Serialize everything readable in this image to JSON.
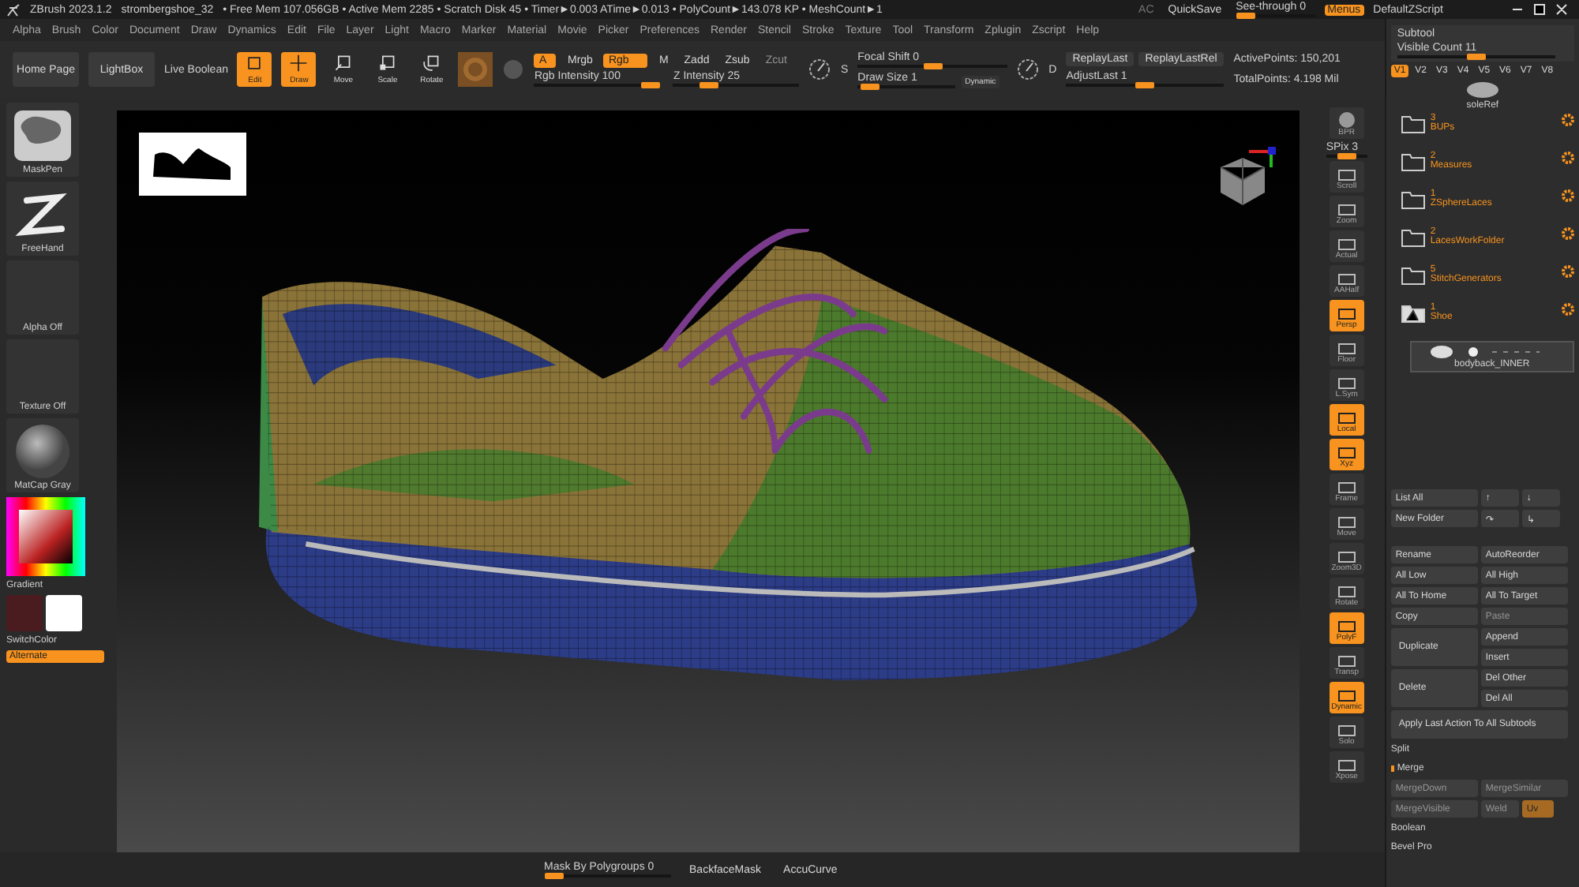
{
  "title_bar": {
    "app": "ZBrush 2023.1.2",
    "document": "strombergshoe_32",
    "stats": "• Free Mem 107.056GB • Active Mem 2285 • Scratch Disk 45 • Timer►0.003 ATime►0.013 • PolyCount►143.078 KP • MeshCount►1",
    "ac": "AC",
    "quicksave": "QuickSave",
    "see_through": {
      "label": "See-through 0",
      "level": 0
    },
    "menus": {
      "label": "Menus",
      "on": true
    },
    "script": "DefaultZScript"
  },
  "menu": [
    "Alpha",
    "Brush",
    "Color",
    "Document",
    "Draw",
    "Dynamics",
    "Edit",
    "File",
    "Layer",
    "Light",
    "Macro",
    "Marker",
    "Material",
    "Movie",
    "Picker",
    "Preferences",
    "Render",
    "Stencil",
    "Stroke",
    "Texture",
    "Tool",
    "Transform",
    "Zplugin",
    "Zscript",
    "Help"
  ],
  "toolbar": {
    "nav": [
      "Home Page",
      "LightBox"
    ],
    "live_boolean": "Live Boolean",
    "modes": [
      {
        "label": "Edit",
        "selected": true
      },
      {
        "label": "Draw",
        "selected": true
      },
      {
        "label": "Move",
        "selected": false
      },
      {
        "label": "Scale",
        "selected": false
      },
      {
        "label": "Rotate",
        "selected": false
      }
    ],
    "channels": [
      {
        "label": "A",
        "on": true,
        "disabled": false
      },
      {
        "label": "Mrgb",
        "on": false,
        "disabled": false
      },
      {
        "label": "Rgb",
        "on": true,
        "disabled": false
      },
      {
        "label": "M",
        "on": false,
        "disabled": false
      },
      {
        "label": "Zadd",
        "on": false,
        "disabled": false
      },
      {
        "label": "Zsub",
        "on": false,
        "disabled": false
      },
      {
        "label": "Zcut",
        "on": false,
        "disabled": true
      }
    ],
    "intensity": [
      {
        "label": "Rgb Intensity 100",
        "level": 1
      },
      {
        "label": "Z Intensity 25",
        "level": 0.25
      }
    ],
    "focal_letter": "S",
    "focal_shift": {
      "label": "Focal Shift 0",
      "level": 0.5
    },
    "draw_size": {
      "label": "Draw Size 1",
      "level": 0.03
    },
    "dynamic": "Dynamic",
    "adjust_letter": "D",
    "replay": [
      "ReplayLast",
      "ReplayLastRel"
    ],
    "adjust_last": {
      "label": "AdjustLast 1",
      "level": 0.5
    },
    "active_points": "ActivePoints: 150,201",
    "total_points": "TotalPoints: 4.198 Mil"
  },
  "left_shelf": {
    "items": [
      {
        "kind": "brush",
        "label": "MaskPen"
      },
      {
        "kind": "stroke",
        "label": "FreeHand"
      },
      {
        "kind": "empty",
        "label": "Alpha Off"
      },
      {
        "kind": "empty",
        "label": "Texture Off"
      },
      {
        "kind": "material",
        "label": "MatCap Gray"
      }
    ],
    "gradient": "Gradient",
    "swatches": [
      {
        "color": "#4a1c20"
      },
      {
        "color": "#ffffff"
      }
    ],
    "switch_color": "SwitchColor",
    "alternate": {
      "label": "Alternate",
      "on": true
    }
  },
  "right_shelf": {
    "bpr": "BPR",
    "spix": {
      "label": "SPix 3",
      "level": 0.5
    },
    "items": [
      {
        "label": "Scroll",
        "on": false
      },
      {
        "label": "Zoom",
        "on": false
      },
      {
        "label": "Actual",
        "on": false
      },
      {
        "label": "AAHalf",
        "on": false
      },
      {
        "label": "Persp",
        "on": true
      },
      {
        "label": "Floor",
        "on": false
      },
      {
        "label": "L.Sym",
        "on": false
      },
      {
        "label": "Local",
        "on": true
      },
      {
        "label": "Xyz",
        "on": true
      },
      {
        "label": "Frame",
        "on": false
      },
      {
        "label": "Move",
        "on": false
      },
      {
        "label": "Zoom3D",
        "on": false
      },
      {
        "label": "Rotate",
        "on": false
      },
      {
        "label": "PolyF",
        "on": true
      },
      {
        "label": "Transp",
        "on": false
      },
      {
        "label": "Dynamic",
        "on": true
      },
      {
        "label": "Solo",
        "on": false
      },
      {
        "label": "Xpose",
        "on": false
      }
    ]
  },
  "bottom_bar": {
    "mask": {
      "label": "Mask By Polygroups 0",
      "level": 0
    },
    "buttons": [
      "BackfaceMask",
      "AccuCurve"
    ]
  },
  "subtool": {
    "title": "Subtool",
    "visible_count": {
      "label": "Visible Count 11",
      "level": 0.5
    },
    "versions": [
      {
        "label": "V1",
        "selected": true
      },
      {
        "label": "V2",
        "selected": false
      },
      {
        "label": "V3",
        "selected": false
      },
      {
        "label": "V4",
        "selected": false
      },
      {
        "label": "V5",
        "selected": false
      },
      {
        "label": "V6",
        "selected": false
      },
      {
        "label": "V7",
        "selected": false
      },
      {
        "label": "V8",
        "selected": false
      }
    ],
    "top_item": "soleRef",
    "folders": [
      {
        "count": "3",
        "name": "BUPs",
        "expanded": false
      },
      {
        "count": "2",
        "name": "Measures",
        "expanded": false
      },
      {
        "count": "1",
        "name": "ZSphereLaces",
        "expanded": false
      },
      {
        "count": "2",
        "name": "LacesWorkFolder",
        "expanded": false
      },
      {
        "count": "5",
        "name": "StitchGenerators",
        "expanded": false
      },
      {
        "count": "1",
        "name": "Shoe",
        "expanded": true
      }
    ],
    "selected_item": "bodyback_INNER",
    "actions": [
      {
        "kind": "pair",
        "items": [
          {
            "label": "List All",
            "disabled": false
          },
          {
            "label": "↑",
            "disabled": false
          },
          {
            "label": "↓",
            "disabled": false
          }
        ]
      },
      {
        "kind": "pair",
        "items": [
          {
            "label": "New Folder",
            "disabled": false
          },
          {
            "label": "↷",
            "disabled": false
          },
          {
            "label": "↳",
            "disabled": false
          }
        ]
      },
      {
        "kind": "gap"
      },
      {
        "kind": "pair",
        "items": [
          {
            "label": "Rename",
            "disabled": false
          },
          {
            "label": "AutoReorder",
            "disabled": false
          }
        ]
      },
      {
        "kind": "pair",
        "items": [
          {
            "label": "All Low",
            "disabled": false
          },
          {
            "label": "All High",
            "disabled": false
          }
        ]
      },
      {
        "kind": "pair",
        "items": [
          {
            "label": "All To Home",
            "disabled": false
          },
          {
            "label": "All To Target",
            "disabled": false
          }
        ]
      },
      {
        "kind": "pair",
        "items": [
          {
            "label": "Copy",
            "disabled": false
          },
          {
            "label": "Paste",
            "disabled": true
          }
        ]
      },
      {
        "kind": "split",
        "main": "Duplicate",
        "items": [
          {
            "label": "Append",
            "disabled": false
          },
          {
            "label": "Insert",
            "disabled": false
          }
        ]
      },
      {
        "kind": "split",
        "main": "Delete",
        "items": [
          {
            "label": "Del Other",
            "disabled": false
          },
          {
            "label": "Del All",
            "disabled": false
          }
        ]
      },
      {
        "kind": "wide",
        "label": "Apply Last Action To All Subtools"
      },
      {
        "kind": "section",
        "label": "Split",
        "marked": false
      },
      {
        "kind": "section",
        "label": "Merge",
        "marked": true
      },
      {
        "kind": "pair",
        "items": [
          {
            "label": "MergeDown",
            "disabled": true
          },
          {
            "label": "MergeSimilar",
            "disabled": true
          }
        ]
      },
      {
        "kind": "pair",
        "items": [
          {
            "label": "MergeVisible",
            "disabled": true
          },
          {
            "label": "Weld",
            "disabled": true
          },
          {
            "label": "Uv",
            "disabled": true,
            "on": true
          }
        ]
      },
      {
        "kind": "section",
        "label": "Boolean",
        "marked": false
      },
      {
        "kind": "section",
        "label": "Bevel Pro",
        "marked": false
      }
    ]
  }
}
